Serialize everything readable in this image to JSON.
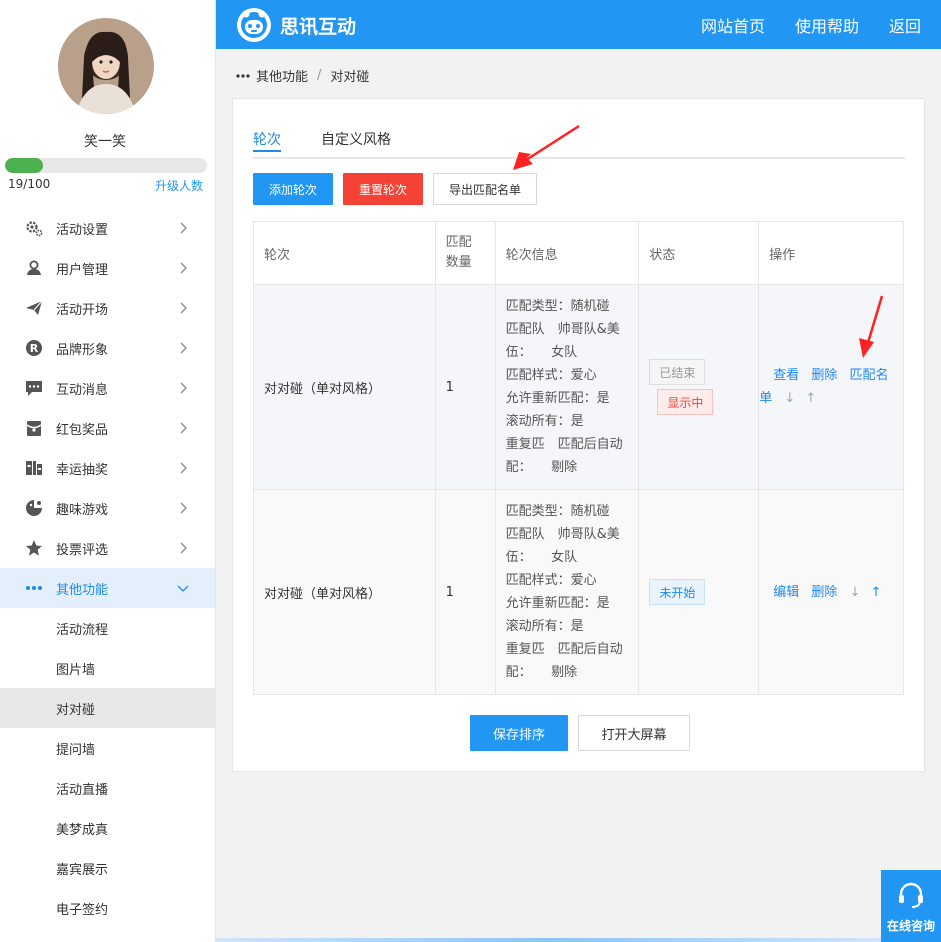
{
  "sidebar": {
    "username": "笑一笑",
    "progress_fraction": 0.19,
    "count": "19/100",
    "upgrade_label": "升级人数",
    "menu": [
      {
        "label": "活动设置",
        "icon": "gear-icon"
      },
      {
        "label": "用户管理",
        "icon": "user-icon"
      },
      {
        "label": "活动开场",
        "icon": "paper-plane-icon"
      },
      {
        "label": "品牌形象",
        "icon": "registered-icon"
      },
      {
        "label": "互动消息",
        "icon": "chat-icon"
      },
      {
        "label": "红包奖品",
        "icon": "red-packet-icon"
      },
      {
        "label": "幸运抽奖",
        "icon": "lottery-icon"
      },
      {
        "label": "趣味游戏",
        "icon": "game-icon"
      },
      {
        "label": "投票评选",
        "icon": "star-icon"
      },
      {
        "label": "其他功能",
        "icon": "more-dots-icon"
      }
    ],
    "submenu": [
      "活动流程",
      "图片墙",
      "对对碰",
      "提问墙",
      "活动直播",
      "美梦成真",
      "嘉宾展示",
      "电子签约"
    ]
  },
  "header": {
    "brand": "思讯互动",
    "nav": [
      "网站首页",
      "使用帮助",
      "返回"
    ]
  },
  "breadcrumb": {
    "parent": "其他功能",
    "separator": "/",
    "current": "对对碰"
  },
  "tabs": [
    "轮次",
    "自定义风格"
  ],
  "buttons": {
    "add": "添加轮次",
    "reset": "重置轮次",
    "export": "导出匹配名单",
    "save_order": "保存排序",
    "open_screen": "打开大屏幕"
  },
  "table": {
    "headers": [
      "轮次",
      "匹配数量",
      "轮次信息",
      "状态",
      "操作"
    ],
    "header_count_lines": [
      "匹配",
      "数量"
    ],
    "rows": [
      {
        "name": "对对碰（单对风格）",
        "count": "1",
        "info": [
          "匹配类型：随机碰",
          "匹配队　帅哥队&美",
          "伍：　　女队",
          "匹配样式：爱心",
          "允许重新匹配：是",
          "滚动所有：是",
          "重复匹　匹配后自动",
          "配：　　剔除"
        ],
        "status": [
          "已结束",
          "显示中"
        ],
        "ops": {
          "a": "查看",
          "b": "删除",
          "c": "匹配名",
          "d": "单",
          "down": "↓",
          "up": "↑"
        }
      },
      {
        "name": "对对碰（单对风格）",
        "count": "1",
        "info": [
          "匹配类型：随机碰",
          "匹配队　帅哥队&美",
          "伍：　　女队",
          "匹配样式：爱心",
          "允许重新匹配：是",
          "滚动所有：是",
          "重复匹　匹配后自动",
          "配：　　剔除"
        ],
        "status": [
          "未开始"
        ],
        "ops": {
          "a": "编辑",
          "b": "删除",
          "down": "↓",
          "up": "↑"
        }
      }
    ]
  },
  "consult": "在线咨询",
  "colors": {
    "primary": "#2196f3",
    "danger": "#f44336",
    "progress": "#4caf50"
  }
}
